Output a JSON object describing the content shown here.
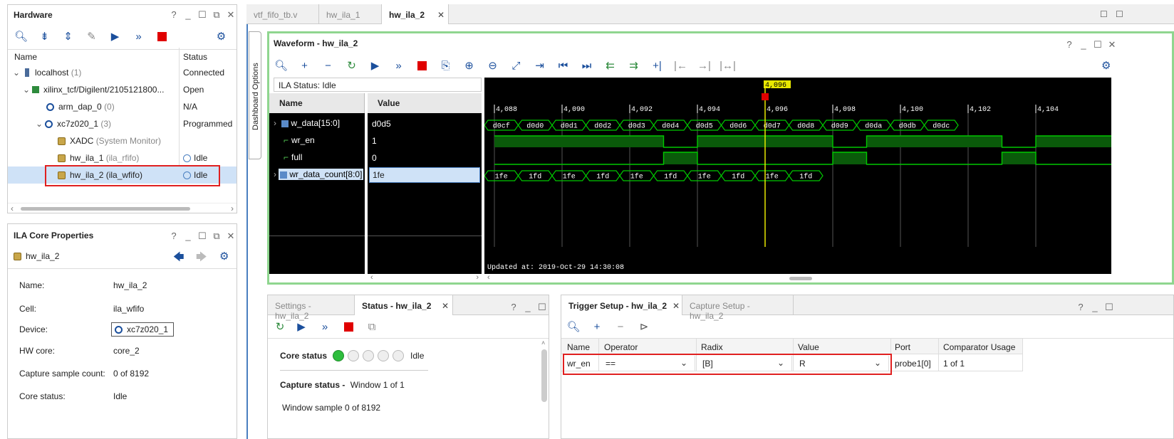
{
  "hardware": {
    "title": "Hardware",
    "col_name": "Name",
    "col_status": "Status",
    "rows": [
      {
        "name": "localhost",
        "extra": "(1)",
        "status": "Connected"
      },
      {
        "name": "xilinx_tcf/Digilent/2105121800...",
        "extra": "",
        "status": "Open"
      },
      {
        "name": "arm_dap_0",
        "extra": "(0)",
        "status": "N/A"
      },
      {
        "name": "xc7z020_1",
        "extra": "(3)",
        "status": "Programmed"
      },
      {
        "name": "XADC",
        "extra": "(System Monitor)",
        "status": ""
      },
      {
        "name": "hw_ila_1",
        "extra": "(ila_rfifo)",
        "status": "Idle"
      },
      {
        "name": "hw_ila_2 (ila_wfifo)",
        "extra": "",
        "status": "Idle"
      }
    ]
  },
  "ila_props": {
    "title": "ILA Core Properties",
    "core": "hw_ila_2",
    "fields": [
      {
        "label": "Name:",
        "value": "hw_ila_2"
      },
      {
        "label": "Cell:",
        "value": "ila_wfifo"
      },
      {
        "label": "Device:",
        "value": "xc7z020_1"
      },
      {
        "label": "HW core:",
        "value": "core_2"
      },
      {
        "label": "Capture sample count:",
        "value": "0 of 8192"
      },
      {
        "label": "Core status:",
        "value": "Idle"
      }
    ]
  },
  "tabs": [
    "vtf_fifo_tb.v",
    "hw_ila_1",
    "hw_ila_2"
  ],
  "dashboard_options": "Dashboard Options",
  "waveform": {
    "title": "Waveform - hw_ila_2",
    "ila_status": "ILA Status:  Idle",
    "col_name": "Name",
    "col_value": "Value",
    "signals": [
      {
        "name": "w_data[15:0]",
        "value": "d0d5"
      },
      {
        "name": "wr_en",
        "value": "1"
      },
      {
        "name": "full",
        "value": "0"
      },
      {
        "name": "wr_data_count[8:0]",
        "value": "1fe"
      }
    ],
    "cursor_label": "4,096",
    "ticks": [
      "4,088",
      "4,090",
      "4,092",
      "4,094",
      "4,096",
      "4,098",
      "4,100",
      "4,102",
      "4,104"
    ],
    "wdata_values": [
      "d0cf",
      "d0d0",
      "d0d1",
      "d0d2",
      "d0d3",
      "d0d4",
      "d0d5",
      "d0d6",
      "d0d7",
      "d0d8",
      "d0d9",
      "d0da",
      "d0db",
      "d0dc"
    ],
    "wr_en_bits": [
      1,
      1,
      1,
      1,
      1,
      0,
      1,
      1,
      1,
      1,
      0,
      1,
      1,
      1,
      1,
      0,
      1,
      1,
      1,
      1
    ],
    "count_values": [
      "1fe",
      "1fd",
      "1fe",
      "1fd",
      "1fe",
      "1fd",
      "1fe",
      "1fd",
      "1fe",
      "1fd"
    ],
    "updated": "Updated at: 2019-Oct-29 14:30:08"
  },
  "status_panel": {
    "tab_settings": "Settings - hw_ila_2",
    "tab_status": "Status - hw_ila_2",
    "core_status_label": "Core status",
    "core_status_value": "Idle",
    "capture_status_label": "Capture status -",
    "capture_status_value": "Window 1 of 1",
    "window_sample": "Window sample 0 of 8192"
  },
  "trigger_panel": {
    "tab_trigger": "Trigger Setup - hw_ila_2",
    "tab_capture": "Capture Setup - hw_ila_2",
    "columns": [
      "Name",
      "Operator",
      "Radix",
      "Value",
      "Port",
      "Comparator Usage"
    ],
    "row": {
      "name": "wr_en",
      "operator": "==",
      "radix": "[B]",
      "value": "R",
      "port": "probe1[0]",
      "usage": "1 of 1"
    }
  },
  "colors": {
    "accent_green": "#00c800",
    "cursor": "#e8e800",
    "selection": "#cfe2f7",
    "highlight": "#e02020"
  }
}
